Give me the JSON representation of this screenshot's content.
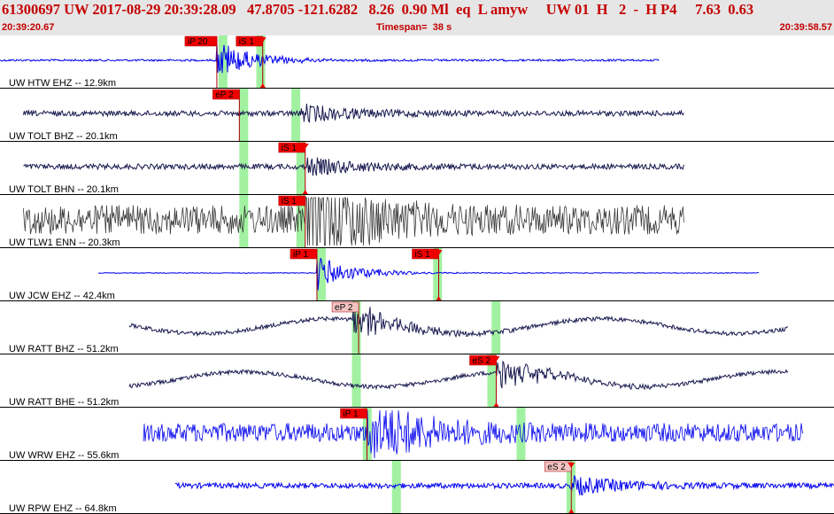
{
  "header": {
    "event_line": "61300697 UW 2017-08-29 20:39:28.09   47.8705 -121.6282   8.26  0.90 Ml  eq  L amyw     UW 01  H   2  -  H P4     7.63  0.63",
    "start_time": "20:39:20.67",
    "timespan_label": "Timespan=",
    "timespan_value": "38 s",
    "end_time": "20:39:58.57"
  },
  "colors": {
    "blue": "#0000ee",
    "navy": "#1a1a50",
    "gray": "#3c3c3c",
    "pick": "#ee0000",
    "pick_light": "#f4c4c4",
    "window": "#90ee90"
  },
  "traces": [
    {
      "label": "UW HTW EHZ -- 12.9km",
      "color": "blue",
      "amp": 0.25,
      "style": "quiet",
      "start": 0.0,
      "end": 0.79,
      "onset": 0.26,
      "green": [
        0.262,
        0.318
      ],
      "picks": [
        {
          "text": "iP 20",
          "pos": 0.26,
          "light": false
        },
        {
          "text": "iS 1",
          "pos": 0.315,
          "light": false,
          "tri": true
        }
      ]
    },
    {
      "label": "UW TOLT BHZ -- 20.1km",
      "color": "navy",
      "amp": 0.22,
      "style": "noise",
      "start": 0.028,
      "end": 0.82,
      "onset": 0.36,
      "green": [
        0.287,
        0.36
      ],
      "picks": [
        {
          "text": "eP 2",
          "pos": 0.287,
          "light": false
        }
      ]
    },
    {
      "label": "UW TOLT BHN -- 20.1km",
      "color": "navy",
      "amp": 0.22,
      "style": "noise",
      "start": 0.028,
      "end": 0.82,
      "onset": 0.366,
      "green": [
        0.287,
        0.366
      ],
      "picks": [
        {
          "text": "iS 1",
          "pos": 0.366,
          "light": false,
          "tri": true
        }
      ]
    },
    {
      "label": "UW TLW1 ENN -- 20.3km",
      "color": "gray",
      "amp": 0.55,
      "style": "dense",
      "start": 0.028,
      "end": 0.82,
      "onset": 0.366,
      "green": [
        0.287,
        0.366
      ],
      "picks": [
        {
          "text": "iS 1",
          "pos": 0.366,
          "light": false
        }
      ]
    },
    {
      "label": "UW JCW EHZ -- 42.4km",
      "color": "blue",
      "amp": 0.1,
      "style": "quiet",
      "start": 0.118,
      "end": 0.91,
      "onset": 0.38,
      "green": [
        0.38,
        0.53
      ],
      "picks": [
        {
          "text": "iP 1",
          "pos": 0.38,
          "light": false
        },
        {
          "text": "iS 1",
          "pos": 0.526,
          "light": false,
          "tri": true
        }
      ]
    },
    {
      "label": "UW RATT BHZ -- 51.2km",
      "color": "navy",
      "amp": 0.22,
      "style": "wave",
      "start": 0.155,
      "end": 0.945,
      "onset": 0.422,
      "green": [
        0.422,
        0.6
      ],
      "picks": [
        {
          "text": "eP 2",
          "pos": 0.43,
          "light": true
        }
      ]
    },
    {
      "label": "UW RATT BHE -- 51.2km",
      "color": "navy",
      "amp": 0.22,
      "style": "wave",
      "start": 0.155,
      "end": 0.945,
      "onset": 0.595,
      "green": [
        0.422,
        0.595
      ],
      "picks": [
        {
          "text": "eS 2",
          "pos": 0.595,
          "light": false,
          "tri": true
        }
      ]
    },
    {
      "label": "UW WRW EHZ -- 55.6km",
      "color": "blue",
      "amp": 0.35,
      "style": "dense",
      "start": 0.172,
      "end": 0.963,
      "onset": 0.44,
      "green": [
        0.435,
        0.63
      ],
      "picks": [
        {
          "text": "iP 1",
          "pos": 0.44,
          "light": false
        }
      ]
    },
    {
      "label": "UW RPW EHZ -- 64.8km",
      "color": "blue",
      "amp": 0.22,
      "style": "noise",
      "start": 0.21,
      "end": 1.0,
      "onset": 0.685,
      "green": [
        0.47,
        0.69
      ],
      "picks": [
        {
          "text": "eS 2",
          "pos": 0.685,
          "light": true,
          "tri": true
        }
      ]
    }
  ]
}
